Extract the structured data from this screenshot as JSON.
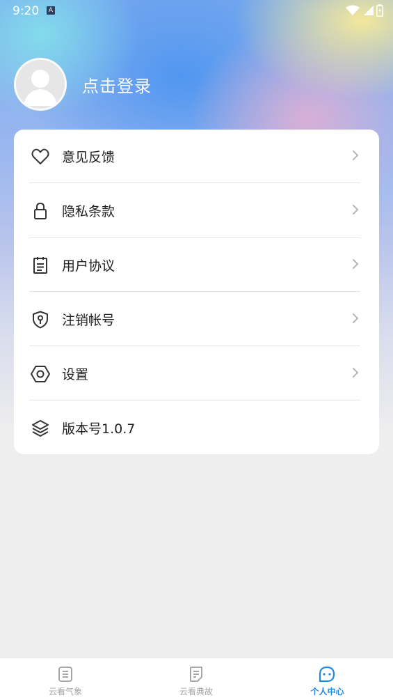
{
  "status": {
    "time": "9:20",
    "notification_glyph": "A",
    "icons": [
      "wifi-icon",
      "signal-icon",
      "battery-icon"
    ]
  },
  "profile": {
    "login_label": "点击登录",
    "avatar_icon": "default-user-avatar"
  },
  "menu": {
    "items": [
      {
        "label": "意见反馈",
        "icon": "heart-icon",
        "has_arrow": true
      },
      {
        "label": "隐私条款",
        "icon": "lock-icon",
        "has_arrow": true
      },
      {
        "label": "用户协议",
        "icon": "clipboard-icon",
        "has_arrow": true
      },
      {
        "label": "注销帐号",
        "icon": "shield-key-icon",
        "has_arrow": true
      },
      {
        "label": "设置",
        "icon": "hexagon-settings-icon",
        "has_arrow": true
      },
      {
        "label": "版本号1.0.7",
        "icon": "layers-icon",
        "has_arrow": false
      }
    ]
  },
  "tabbar": {
    "tabs": [
      {
        "label": "云看气象",
        "icon": "notebook-icon",
        "active": false
      },
      {
        "label": "云看典故",
        "icon": "document-icon",
        "active": false
      },
      {
        "label": "个人中心",
        "icon": "chat-face-icon",
        "active": true
      }
    ]
  },
  "colors": {
    "accent": "#1e88e5",
    "inactive_tab": "#a6a6a6",
    "menu_text": "#222222",
    "page_bg": "#eeeeee"
  }
}
